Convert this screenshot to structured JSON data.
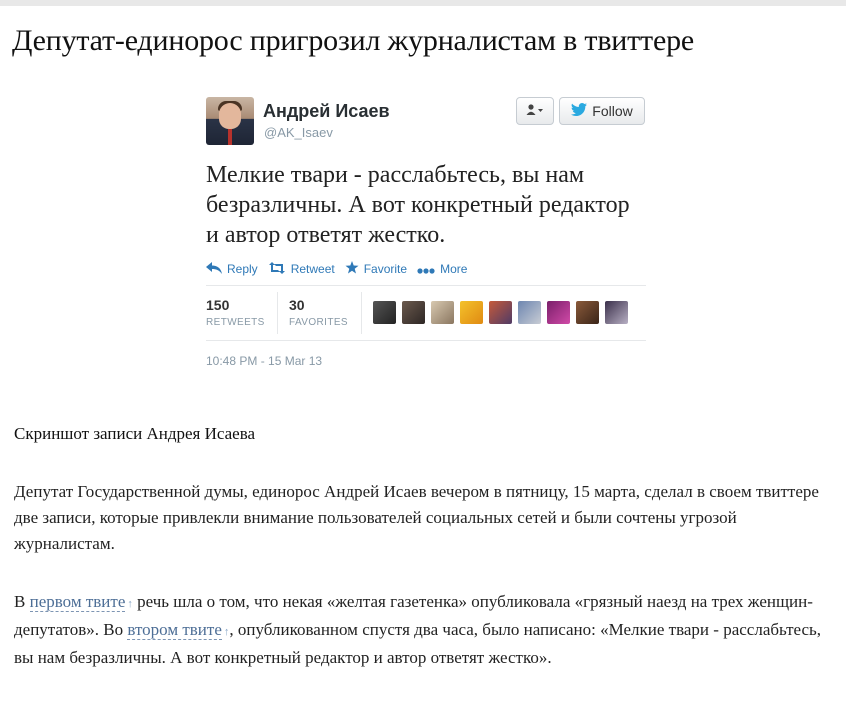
{
  "article": {
    "headline": "Депутат-единорос пригрозил журналистам в твиттере",
    "caption": "Скриншот записи Андрея Исаева",
    "paragraph1": "Депутат Государственной думы, единорос Андрей Исаев вечером в пятницу, 15 марта, сделал в своем твиттере две записи, которые привлекли внимание пользователей социальных сетей и были сочтены угрозой журналистам.",
    "paragraph2": {
      "t1": "В ",
      "link1": "первом твите",
      "t2": " речь шла о том, что некая «желтая газетенка» опубликовала «грязный наезд на трех женщин-депутатов». Во ",
      "link2": "втором твите",
      "t3": ", опубликованном спустя два часа, было написано: «Мелкие твари - расслабьтесь, вы нам безразличны. А вот конкретный редактор и автор ответят жестко»."
    },
    "link_icon": "external-link-icon"
  },
  "tweet": {
    "author_name": "Андрей Исаев",
    "handle": "@AK_Isaev",
    "follow_label": "Follow",
    "user_menu_icon": "user-dropdown-icon",
    "text": "Мелкие твари - расслабьтесь, вы нам безразличны. А вот конкретный редактор и автор ответят жестко.",
    "actions": {
      "reply": "Reply",
      "retweet": "Retweet",
      "favorite": "Favorite",
      "more": "More"
    },
    "stats": {
      "retweets_count": "150",
      "retweets_label": "RETWEETS",
      "favorites_count": "30",
      "favorites_label": "FAVORITES"
    },
    "timestamp": "10:48 PM - 15 Mar 13",
    "colors": {
      "link": "#2f79b7",
      "twitter_bird": "#2aa9e0",
      "muted": "#8899a6"
    }
  }
}
